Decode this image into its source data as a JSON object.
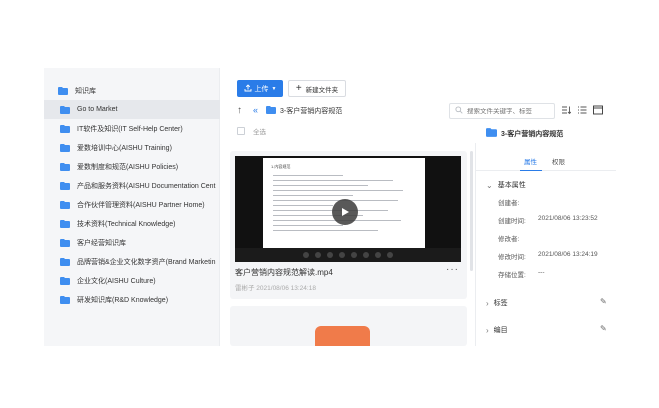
{
  "sidebar": {
    "root_label": "知识库",
    "items": [
      {
        "label": "Go to Market",
        "active": true
      },
      {
        "label": "IT软件及知识(IT Self-Help Center)"
      },
      {
        "label": "爱数培训中心(AISHU Training)"
      },
      {
        "label": "爱数制度和规范(AISHU Policies)"
      },
      {
        "label": "产品和服务资料(AISHU Documentation Cent"
      },
      {
        "label": "合作伙伴管理资料(AISHU Partner Home)"
      },
      {
        "label": "技术资料(Technical Knowledge)"
      },
      {
        "label": "客户经营知识库"
      },
      {
        "label": "品牌营销&企业文化数字资产(Brand Marketin"
      },
      {
        "label": "企业文化(AISHU Culture)"
      },
      {
        "label": "研发知识库(R&D Knowledge)"
      }
    ]
  },
  "toolbar": {
    "upload_label": "上传",
    "new_folder_label": "新建文件夹"
  },
  "breadcrumb": {
    "up_icon": "arrow-up-icon",
    "back_icon": "double-chevron-left-icon",
    "current": "3-客户营销内容规范"
  },
  "search": {
    "placeholder": "搜索文件关键字、标签"
  },
  "list": {
    "select_all_label": "全选",
    "files": [
      {
        "name": "客户营销内容规范解读.mp4",
        "meta": "雷彬子 2021/08/06 13:24:18",
        "slide_title": "1.内容规范"
      }
    ]
  },
  "detail": {
    "title": "3-客户营销内容规范",
    "tabs": [
      "属性",
      "权限"
    ],
    "basic_section": "基本属性",
    "rows": [
      {
        "label": "创建者:",
        "value": ""
      },
      {
        "label": "创建时间:",
        "value": "2021/08/06 13:23:52"
      },
      {
        "label": "修改者:",
        "value": ""
      },
      {
        "label": "修改时间:",
        "value": "2021/08/06 13:24:19"
      },
      {
        "label": "存储位置:",
        "value": "---"
      }
    ],
    "tags_section": "标签",
    "catalog_section": "编目"
  },
  "colors": {
    "accent": "#2a7ce8",
    "folder": "#3f8ef0",
    "sidebar_bg": "#f5f6f8"
  }
}
